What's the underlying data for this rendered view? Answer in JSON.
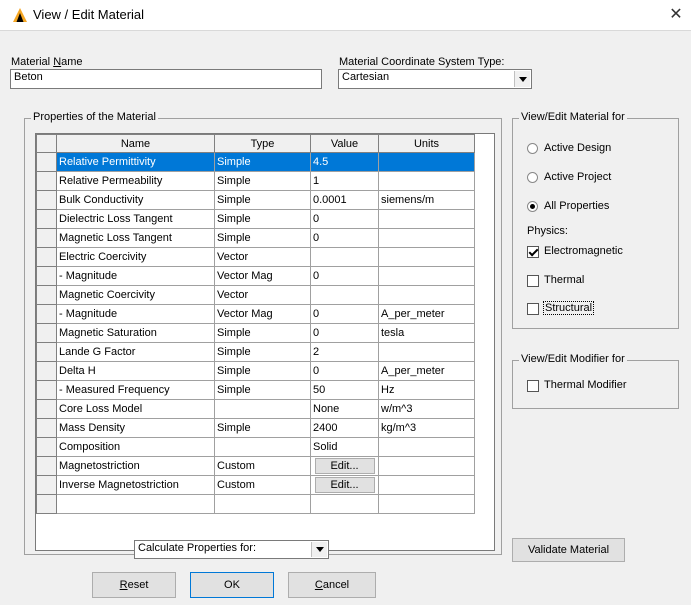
{
  "window": {
    "title": "View / Edit Material",
    "close_glyph": "✕"
  },
  "material_name": {
    "label_pre": "Material ",
    "label_mnemonic": "N",
    "label_post": "ame",
    "value": "Beton"
  },
  "coord_system": {
    "label": "Material Coordinate System Type:",
    "value": "Cartesian"
  },
  "properties": {
    "title": "Properties of the Material",
    "columns": [
      "Name",
      "Type",
      "Value",
      "Units"
    ],
    "selected_index": 0,
    "rows": [
      {
        "name": "Relative Permittivity",
        "type": "Simple",
        "value": "4.5",
        "units": ""
      },
      {
        "name": "Relative Permeability",
        "type": "Simple",
        "value": "1",
        "units": ""
      },
      {
        "name": "Bulk Conductivity",
        "type": "Simple",
        "value": "0.0001",
        "units": "siemens/m"
      },
      {
        "name": "Dielectric Loss Tangent",
        "type": "Simple",
        "value": "0",
        "units": ""
      },
      {
        "name": "Magnetic Loss Tangent",
        "type": "Simple",
        "value": "0",
        "units": ""
      },
      {
        "name": "Electric Coercivity",
        "type": "Vector",
        "value": "",
        "units": ""
      },
      {
        "name": "- Magnitude",
        "type": "Vector Mag",
        "value": "0",
        "units": ""
      },
      {
        "name": "Magnetic Coercivity",
        "type": "Vector",
        "value": "",
        "units": ""
      },
      {
        "name": "- Magnitude",
        "type": "Vector Mag",
        "value": "0",
        "units": "A_per_meter"
      },
      {
        "name": "Magnetic Saturation",
        "type": "Simple",
        "value": "0",
        "units": "tesla"
      },
      {
        "name": "Lande G Factor",
        "type": "Simple",
        "value": "2",
        "units": ""
      },
      {
        "name": "Delta H",
        "type": "Simple",
        "value": "0",
        "units": "A_per_meter"
      },
      {
        "name": "- Measured Frequency",
        "type": "Simple",
        "value": "50",
        "units": "Hz"
      },
      {
        "name": "Core Loss Model",
        "type": "",
        "value": "None",
        "units": "w/m^3"
      },
      {
        "name": "Mass Density",
        "type": "Simple",
        "value": "2400",
        "units": "kg/m^3"
      },
      {
        "name": "Composition",
        "type": "",
        "value": "Solid",
        "units": ""
      },
      {
        "name": "Magnetostriction",
        "type": "Custom",
        "value": "Edit...",
        "units": "",
        "button": true
      },
      {
        "name": "Inverse Magnetostriction",
        "type": "Custom",
        "value": "Edit...",
        "units": "",
        "button": true
      }
    ]
  },
  "view_edit": {
    "title": "View/Edit Material for",
    "active_design": "Active Design",
    "active_project": "Active Project",
    "all_properties": "All Properties",
    "physics_label": "Physics:",
    "electromagnetic": "Electromagnetic",
    "thermal": "Thermal",
    "structural": "Structural"
  },
  "modifier": {
    "title": "View/Edit Modifier for",
    "thermal_modifier": "Thermal Modifier"
  },
  "calculate": {
    "value": "Calculate Properties for:"
  },
  "buttons": {
    "validate": "Validate Material",
    "reset_mnemonic": "R",
    "reset_rest": "eset",
    "ok": "OK",
    "cancel_mnemonic": "C",
    "cancel_rest": "ancel"
  },
  "colors": {
    "selection": "#0078d7",
    "dialog_bg": "#f0f0f0",
    "logo": "#f5a623"
  }
}
